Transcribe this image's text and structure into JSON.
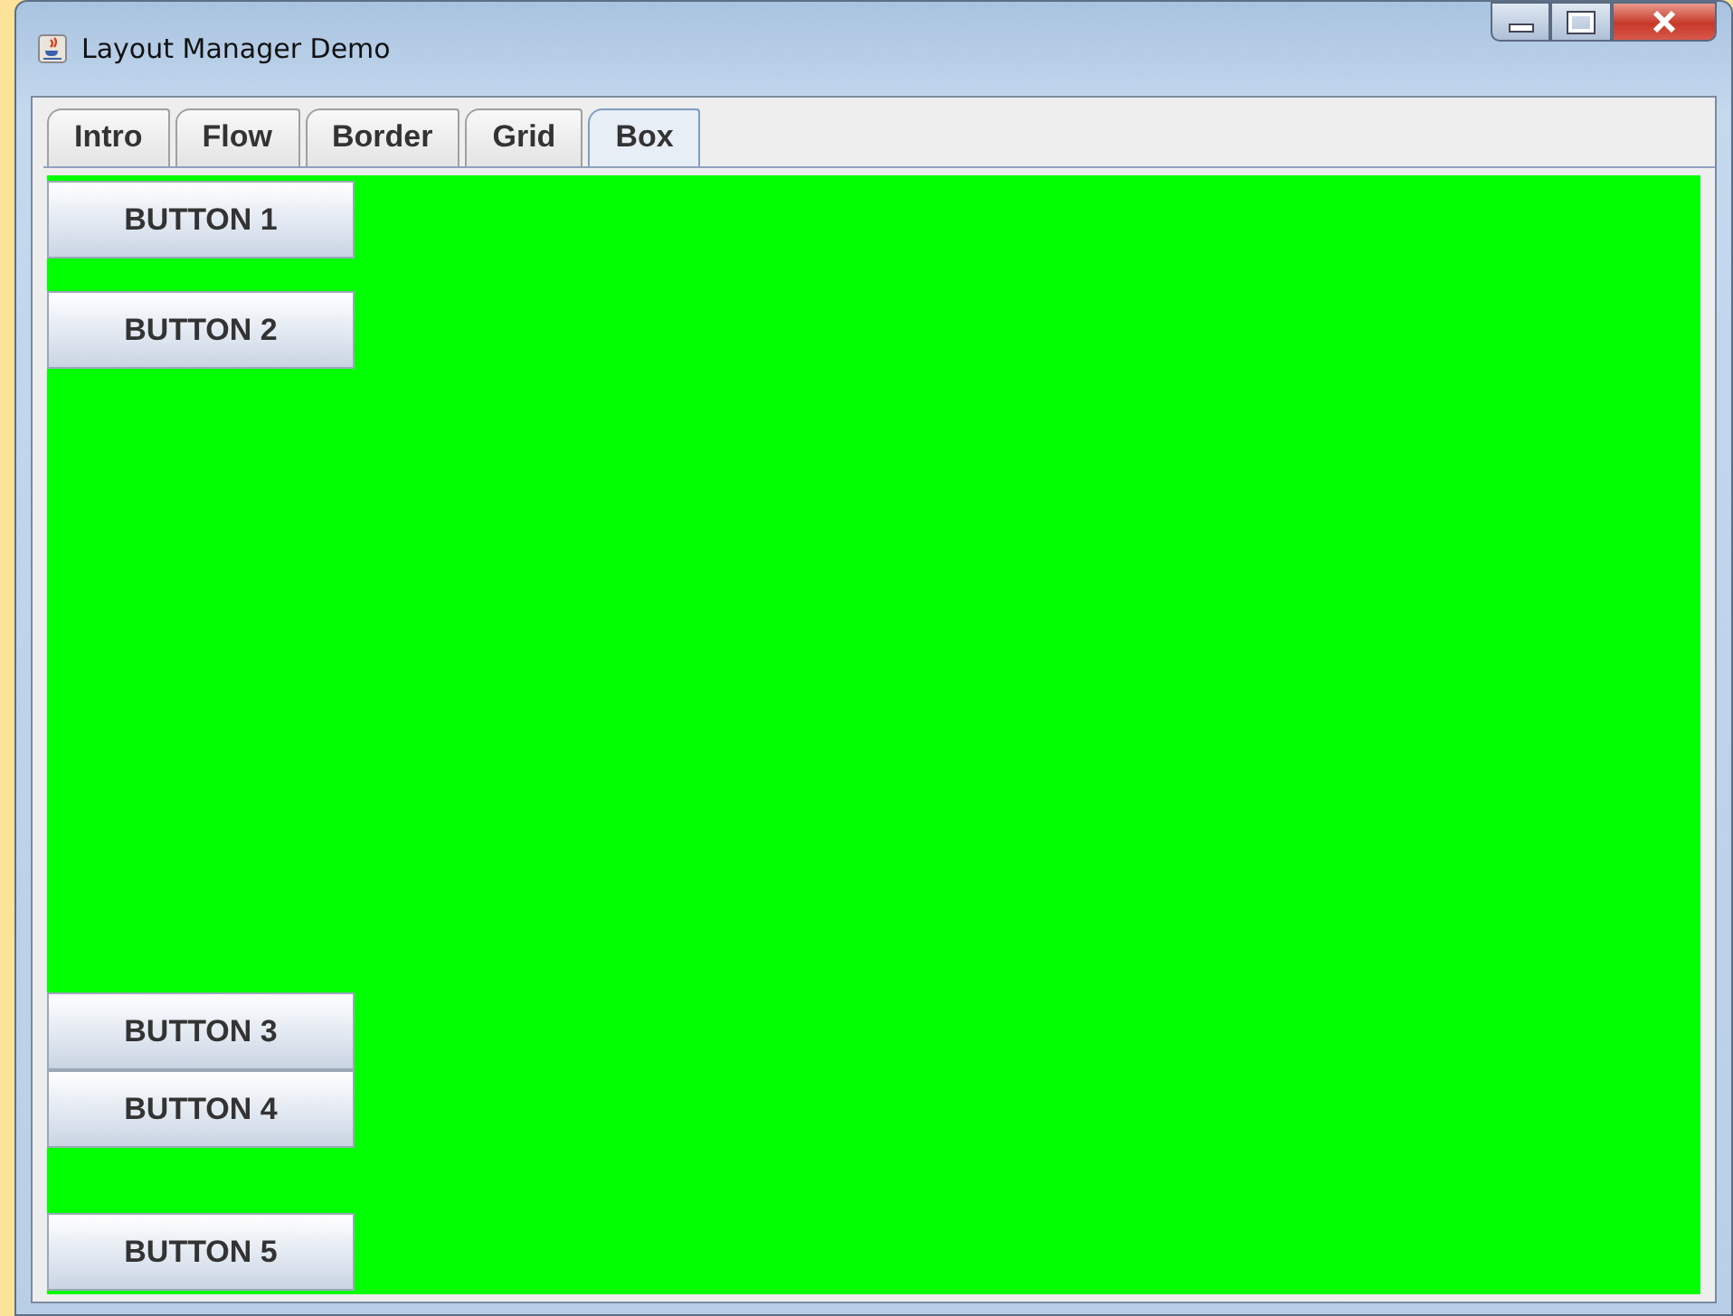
{
  "window": {
    "title": "Layout Manager Demo"
  },
  "tabs": [
    {
      "label": "Intro",
      "selected": false
    },
    {
      "label": "Flow",
      "selected": false
    },
    {
      "label": "Border",
      "selected": false
    },
    {
      "label": "Grid",
      "selected": false
    },
    {
      "label": "Box",
      "selected": true
    }
  ],
  "buttons": [
    "BUTTON 1",
    "BUTTON 2",
    "BUTTON 3",
    "BUTTON 4",
    "BUTTON 5"
  ]
}
